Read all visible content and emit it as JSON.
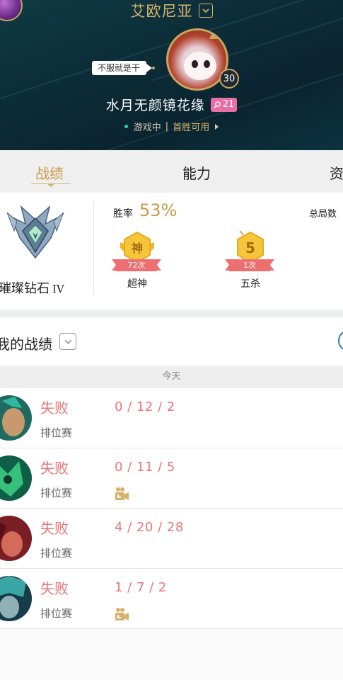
{
  "header": {
    "server_name": "艾欧尼亚",
    "level": "30",
    "motto": "不服就是干",
    "nickname": "水月无颜镜花缘",
    "honor_level": "21",
    "status": "游戏中",
    "status_sep": "|",
    "first_win": "首胜可用"
  },
  "tabs": [
    {
      "label": "战绩",
      "active": true
    },
    {
      "label": "能力",
      "active": false
    },
    {
      "label": "资",
      "active": false
    }
  ],
  "stats": {
    "rank_name": "璀璨钻石",
    "rank_tier": "IV",
    "winrate_label": "胜率",
    "winrate_value": "53%",
    "total_label": "总局数",
    "medals": [
      {
        "glyph": "神",
        "count": "72次",
        "caption": "超神"
      },
      {
        "glyph": "5",
        "count": "1次",
        "caption": "五杀"
      }
    ]
  },
  "record": {
    "title": "我的战绩",
    "date_label": "今天"
  },
  "matches": [
    {
      "result": "失败",
      "queue": "排位赛",
      "kda": "0 / 12 / 2",
      "has_video": false,
      "champ_colors": [
        "#1f6b5f",
        "#c79a6e"
      ]
    },
    {
      "result": "失败",
      "queue": "排位赛",
      "kda": "0 / 11 / 5",
      "has_video": true,
      "champ_colors": [
        "#0f5e46",
        "#37c07a"
      ]
    },
    {
      "result": "失败",
      "queue": "排位赛",
      "kda": "4 / 20 / 28",
      "has_video": false,
      "champ_colors": [
        "#7a1e26",
        "#d46a5a"
      ]
    },
    {
      "result": "失败",
      "queue": "排位赛",
      "kda": "1 / 7 / 2",
      "has_video": true,
      "champ_colors": [
        "#163c4a",
        "#3aa7a6"
      ]
    }
  ],
  "colors": {
    "gold": "#c89b4c",
    "defeat": "#e97677",
    "honor_pink": "#e96ea3",
    "medal_yellow": "#f4c22b",
    "ribbon_red": "#ee6f71"
  },
  "icons": {
    "server_toggle": "chevron-down-icon",
    "honor": "search-icon",
    "status_arrow": "chevron-right-icon",
    "record_toggle": "chevron-down-icon",
    "video": "video-camera-icon"
  }
}
